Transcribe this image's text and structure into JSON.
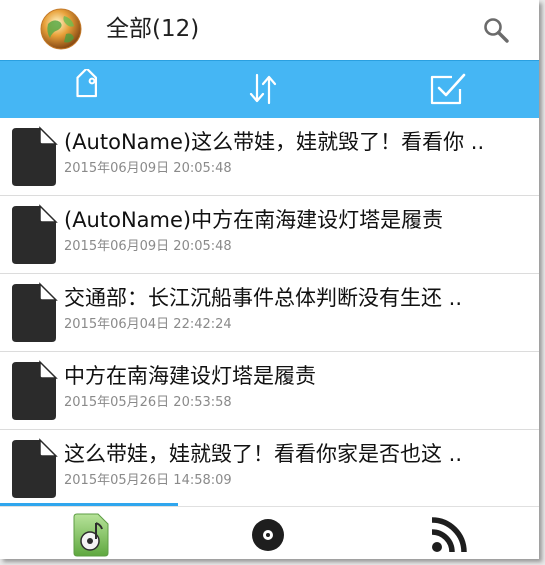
{
  "header": {
    "title": "全部(12)",
    "logo_icon": "globe-icon",
    "search_icon": "search-icon"
  },
  "toolbar": {
    "items": [
      {
        "icon": "tag-icon"
      },
      {
        "icon": "sort-arrows-icon"
      },
      {
        "icon": "checkbox-icon"
      }
    ],
    "color": "#45b6f4"
  },
  "list": {
    "items": [
      {
        "title": "(AutoName)这么带娃，娃就毁了！看看你 ..",
        "date": "2015年06月09日 20:05:48",
        "icon": "document-icon"
      },
      {
        "title": "(AutoName)中方在南海建设灯塔是履责",
        "date": "2015年06月09日 20:05:48",
        "icon": "document-icon"
      },
      {
        "title": "交通部：长江沉船事件总体判断没有生还 ..",
        "date": "2015年06月04日 22:42:24",
        "icon": "document-icon"
      },
      {
        "title": "中方在南海建设灯塔是履责",
        "date": "2015年05月26日 20:53:58",
        "icon": "document-icon"
      },
      {
        "title": "这么带娃，娃就毁了！看看你家是否也这 ..",
        "date": "2015年05月26日 14:58:09",
        "icon": "document-icon"
      }
    ]
  },
  "bottom_nav": {
    "items": [
      {
        "icon": "music-file-icon"
      },
      {
        "icon": "disc-icon"
      },
      {
        "icon": "rss-icon"
      }
    ]
  },
  "progress": 0.33
}
